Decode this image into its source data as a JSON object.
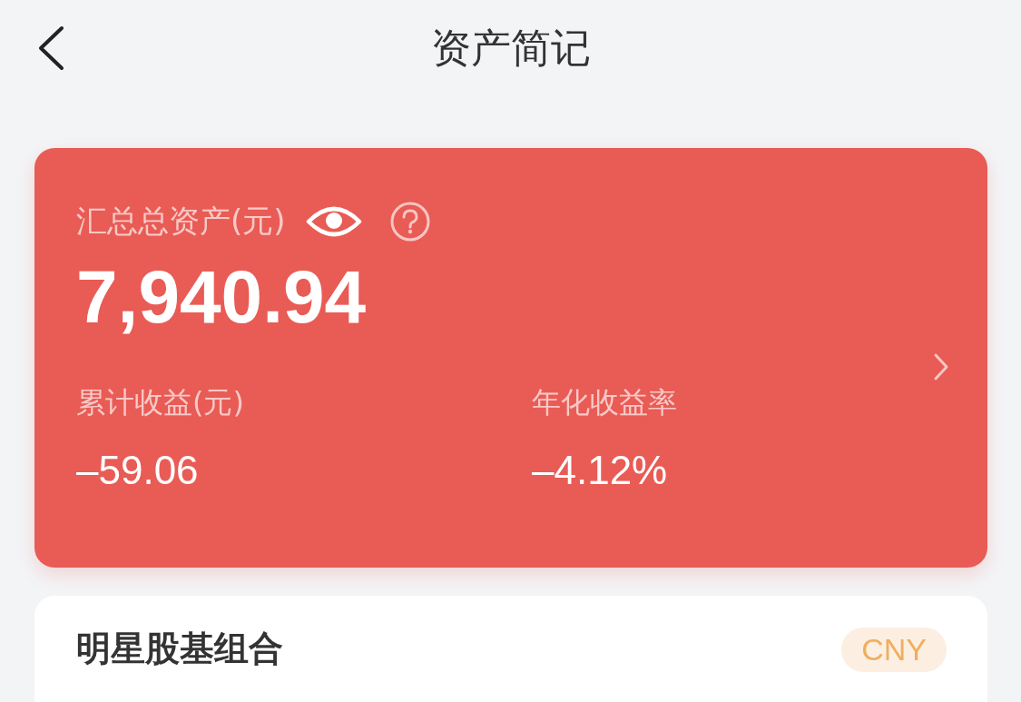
{
  "header": {
    "title": "资产简记"
  },
  "summary": {
    "label": "汇总总资产(元)",
    "amount": "7,940.94",
    "stats": [
      {
        "label": "累计收益(元)",
        "value": "–59.06"
      },
      {
        "label": "年化收益率",
        "value": "–4.12%"
      }
    ]
  },
  "portfolio": {
    "name": "明星股基组合",
    "currency": "CNY"
  }
}
